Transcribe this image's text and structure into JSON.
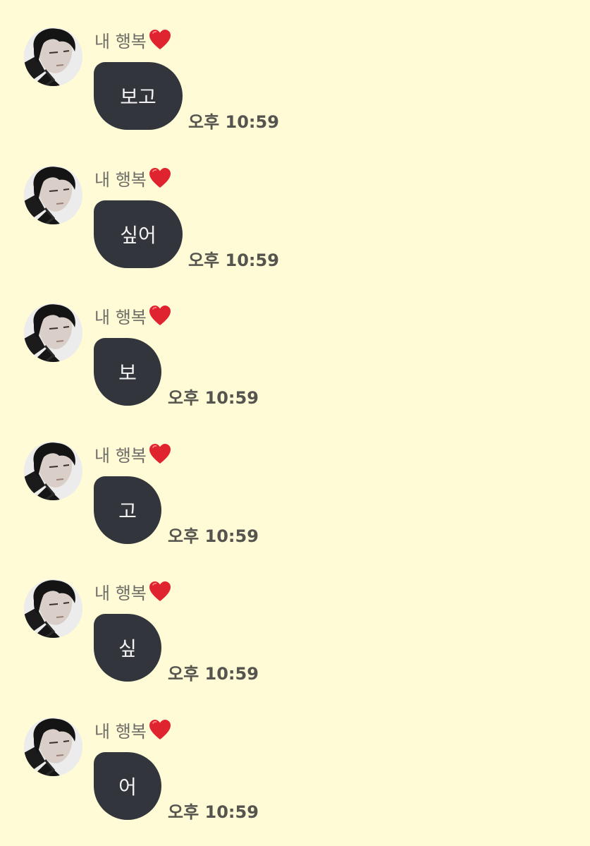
{
  "chat": {
    "messages": [
      {
        "sender": "내 행복",
        "sender_icon": "red-heart-icon",
        "avatar": "profile-photo",
        "text": "보고",
        "time": "오후 10:59"
      },
      {
        "sender": "내 행복",
        "sender_icon": "red-heart-icon",
        "avatar": "profile-photo",
        "text": "싶어",
        "time": "오후 10:59"
      },
      {
        "sender": "내 행복",
        "sender_icon": "red-heart-icon",
        "avatar": "profile-photo",
        "text": "보",
        "time": "오후 10:59"
      },
      {
        "sender": "내 행복",
        "sender_icon": "red-heart-icon",
        "avatar": "profile-photo",
        "text": "고",
        "time": "오후 10:59"
      },
      {
        "sender": "내 행복",
        "sender_icon": "red-heart-icon",
        "avatar": "profile-photo",
        "text": "싶",
        "time": "오후 10:59"
      },
      {
        "sender": "내 행복",
        "sender_icon": "red-heart-icon",
        "avatar": "profile-photo",
        "text": "어",
        "time": "오후 10:59"
      }
    ]
  },
  "colors": {
    "background": "#fffbd6",
    "bubble": "#33353c",
    "bubble_text": "#f2f2f2",
    "sender_text": "#6d6c66",
    "time_text": "#55544e",
    "heart": "#e0242f"
  }
}
